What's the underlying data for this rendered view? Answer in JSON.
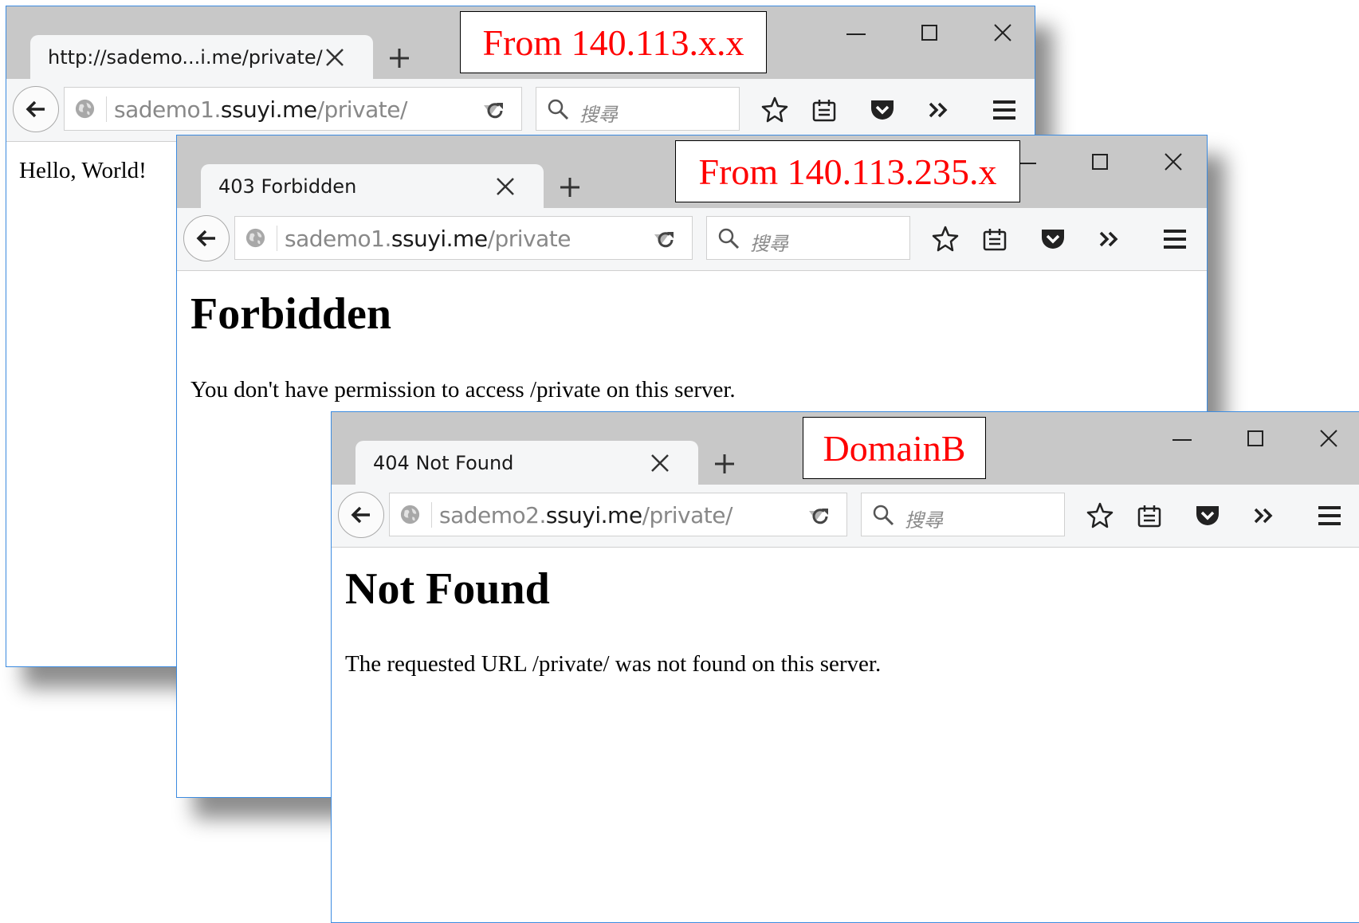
{
  "windows": [
    {
      "tab_title": "http://sademo...i.me/private/",
      "url_prefix": "sademo1.",
      "url_domain": "ssuyi.me",
      "url_path": "/private/",
      "search_placeholder": "搜尋",
      "body_text": "Hello, World!",
      "annotation": "From 140.113.x.x"
    },
    {
      "tab_title": "403 Forbidden",
      "url_prefix": "sademo1.",
      "url_domain": "ssuyi.me",
      "url_path": "/private",
      "search_placeholder": "搜尋",
      "heading": "Forbidden",
      "body_text": "You don't have permission to access /private on this server.",
      "annotation": "From 140.113.235.x"
    },
    {
      "tab_title": "404 Not Found",
      "url_prefix": "sademo2.",
      "url_domain": "ssuyi.me",
      "url_path": "/private/",
      "search_placeholder": "搜尋",
      "heading": "Not Found",
      "body_text": "The requested URL /private/ was not found on this server.",
      "annotation": "DomainB"
    }
  ],
  "colors": {
    "window_border": "#3c8be0",
    "titlebar": "#c8c8c8",
    "toolbar": "#f5f6f7",
    "annotation_text": "#ff0000"
  },
  "icons": [
    "close-tab-icon",
    "new-tab-icon",
    "minimize-icon",
    "maximize-icon",
    "close-window-icon",
    "back-arrow-icon",
    "globe-icon",
    "dropdown-arrow-icon",
    "reload-icon",
    "search-icon",
    "star-bookmark-icon",
    "reading-list-icon",
    "pocket-icon",
    "overflow-chevron-icon",
    "hamburger-menu-icon"
  ]
}
